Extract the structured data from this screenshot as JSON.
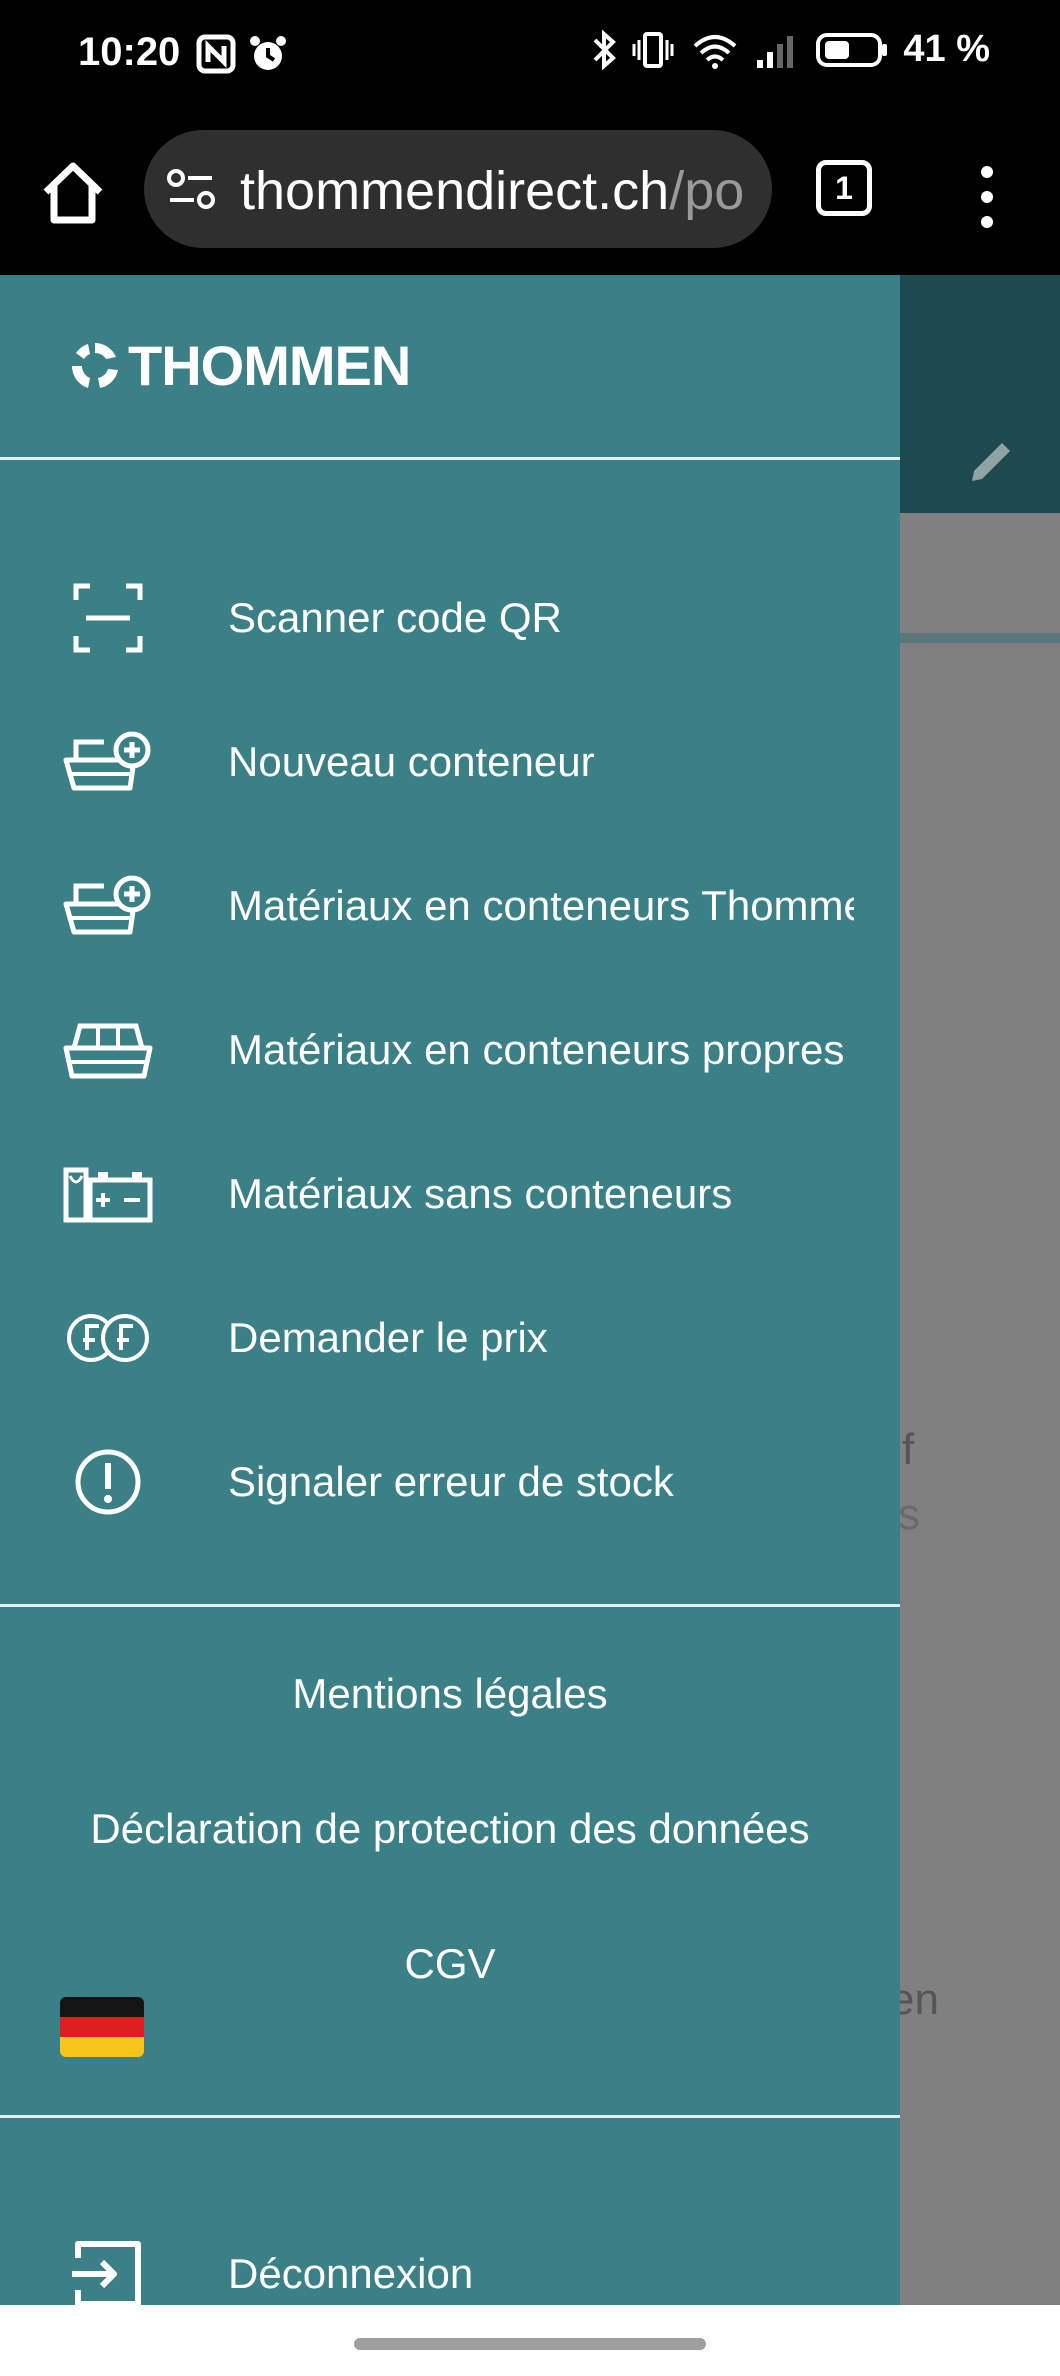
{
  "status": {
    "time": "10:20",
    "battery": "41 %"
  },
  "browser": {
    "url_main": "thommendirect.ch",
    "url_dim": "/po",
    "tab_count": "1"
  },
  "drawer": {
    "brand": "THOMMEN",
    "items": [
      {
        "label": "Scanner code QR",
        "icon": "qr-scan-icon"
      },
      {
        "label": "Nouveau conteneur",
        "icon": "container-add-icon"
      },
      {
        "label": "Matériaux en conteneurs Thommen",
        "icon": "container-add-icon"
      },
      {
        "label": "Matériaux en conteneurs propres",
        "icon": "container-icon"
      },
      {
        "label": "Matériaux sans conteneurs",
        "icon": "battery-materials-icon"
      },
      {
        "label": "Demander le prix",
        "icon": "franc-coins-icon"
      },
      {
        "label": "Signaler erreur de stock",
        "icon": "alert-circle-icon"
      }
    ],
    "footer": {
      "legal": "Mentions légales",
      "privacy": "Déclaration de protection des données",
      "terms": "CGV"
    },
    "language_flag": "de",
    "logout": "Déconnexion"
  },
  "background": {
    "fragments": [
      "f",
      "s",
      "en"
    ]
  },
  "colors": {
    "drawer_bg": "#3b8087",
    "header_bg": "#1e4a4f"
  }
}
